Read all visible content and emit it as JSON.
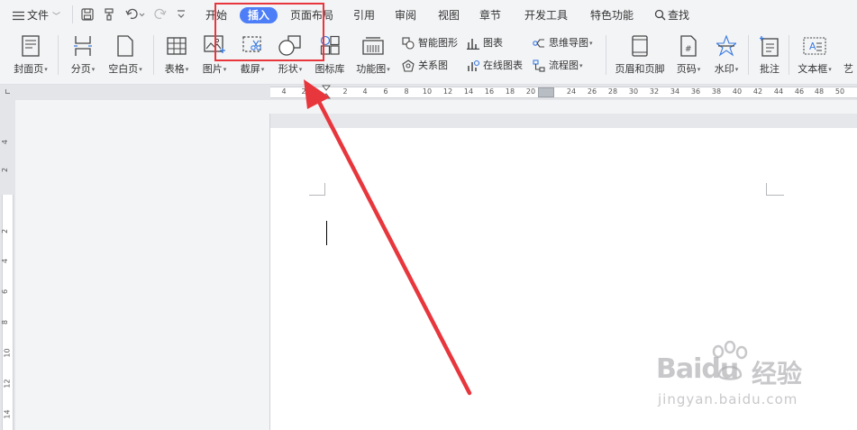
{
  "menu": {
    "file_label": "文件",
    "tabs": [
      {
        "label": "开始"
      },
      {
        "label": "插入",
        "active": true
      },
      {
        "label": "页面布局"
      },
      {
        "label": "引用"
      },
      {
        "label": "审阅"
      },
      {
        "label": "视图"
      },
      {
        "label": "章节"
      },
      {
        "label": "开发工具"
      },
      {
        "label": "特色功能"
      }
    ],
    "search_label": "查找"
  },
  "ribbon": {
    "cover_page": "封面页",
    "page_break": "分页",
    "blank_page": "空白页",
    "table": "表格",
    "picture": "图片",
    "screenshot": "截屏",
    "shape": "形状",
    "icon_library": "图标库",
    "function_chart": "功能图",
    "smart_shape": "智能图形",
    "chart": "图表",
    "relation_chart": "关系图",
    "online_chart": "在线图表",
    "mind_map": "思维导图",
    "flowchart": "流程图",
    "header_footer": "页眉和页脚",
    "page_number": "页码",
    "watermark": "水印",
    "comment": "批注",
    "text_box": "文本框",
    "art_word": "艺"
  },
  "ruler": {
    "h_ticks": [
      "4",
      "2",
      "2",
      "4",
      "6",
      "8",
      "10",
      "12",
      "14",
      "16",
      "18",
      "20",
      "24",
      "26",
      "28",
      "30",
      "32",
      "34",
      "36",
      "38",
      "40",
      "42",
      "44",
      "46",
      "48",
      "50"
    ],
    "v_ticks": [
      "4",
      "2",
      "2",
      "4",
      "6",
      "8",
      "10",
      "12",
      "14"
    ]
  },
  "watermark": {
    "brand": "Baidu",
    "brand_cn": "经验",
    "url": "jingyan.baidu.com"
  },
  "colors": {
    "accent": "#4d7ef7",
    "highlight": "#e8363d",
    "arrow": "#e8363d"
  }
}
